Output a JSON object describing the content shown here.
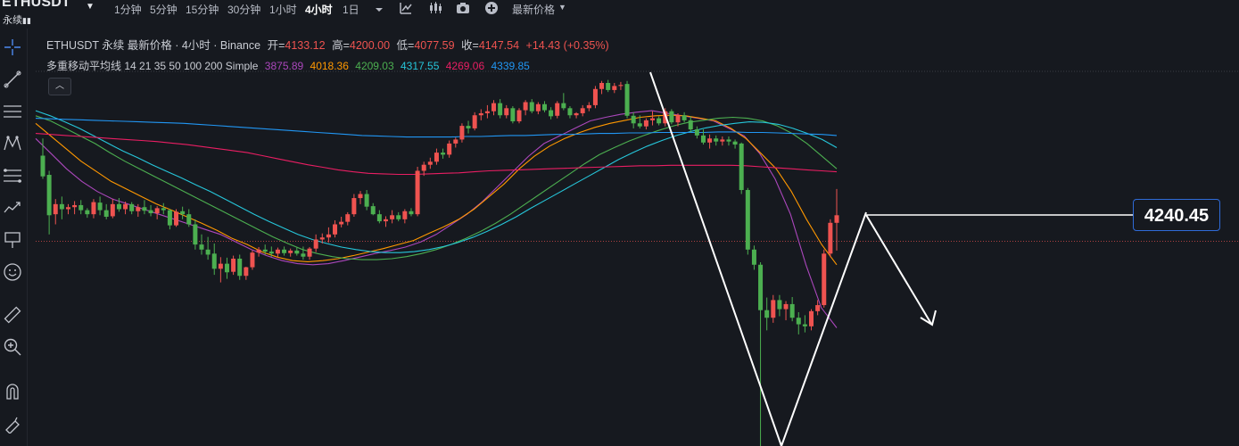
{
  "header": {
    "symbol": "ETHUSDT",
    "perp_tag": "永续",
    "timeframes": [
      {
        "label": "1分钟",
        "active": false
      },
      {
        "label": "5分钟",
        "active": false
      },
      {
        "label": "15分钟",
        "active": false
      },
      {
        "label": "30分钟",
        "active": false
      },
      {
        "label": "1小时",
        "active": false
      },
      {
        "label": "4小时",
        "active": true
      },
      {
        "label": "1日",
        "active": false
      }
    ],
    "icons": [
      "chevron-down-icon",
      "candle-style-icon",
      "indicator-icon",
      "camera-icon",
      "add-icon"
    ],
    "price_mode": "最新价格"
  },
  "toolbar": {
    "tools": [
      "crosshair-icon",
      "trend-line-icon",
      "horizontal-lines-icon",
      "pattern-icon",
      "fib-icon",
      "forecast-icon",
      "annotation-icon",
      "emoji-icon",
      "ruler-icon",
      "zoom-icon",
      "magnet-icon",
      "lock-drawing-icon"
    ]
  },
  "legend": {
    "title": "ETHUSDT 永续 最新价格 · 4小时 · Binance",
    "open_label": "开=",
    "open": "4133.12",
    "high_label": "高=",
    "high": "4200.00",
    "low_label": "低=",
    "low": "4077.59",
    "close_label": "收=",
    "close": "4147.54",
    "change": "+14.43 (+0.35%)",
    "ma_title": "多重移动平均线 14 21 35 50 100 200 Simple",
    "ma_values": [
      {
        "value": "3875.89",
        "color": "#ab47bc"
      },
      {
        "value": "4018.36",
        "color": "#ff9800"
      },
      {
        "value": "4209.03",
        "color": "#4caf50"
      },
      {
        "value": "4317.55",
        "color": "#26c6da"
      },
      {
        "value": "4269.06",
        "color": "#e91e63"
      },
      {
        "value": "4339.85",
        "color": "#2196f3"
      }
    ]
  },
  "collapse_button": "︿",
  "drawing": {
    "price_label": "4240.45"
  },
  "colors": {
    "background": "#16191f",
    "up": "#ef5350",
    "down": "#4caf50",
    "price_line": "#ef5350"
  },
  "chart_data": {
    "type": "candlestick",
    "symbol": "ETHUSDT",
    "interval": "4小时",
    "price_range": [
      3880,
      4410
    ],
    "candles": [
      [
        4266,
        4300,
        4220,
        4225
      ],
      [
        4228,
        4236,
        4110,
        4148
      ],
      [
        4150,
        4180,
        4130,
        4170
      ],
      [
        4170,
        4185,
        4140,
        4160
      ],
      [
        4160,
        4170,
        4150,
        4164
      ],
      [
        4164,
        4176,
        4150,
        4168
      ],
      [
        4168,
        4178,
        4150,
        4158
      ],
      [
        4158,
        4162,
        4143,
        4150
      ],
      [
        4150,
        4180,
        4142,
        4174
      ],
      [
        4173,
        4185,
        4148,
        4158
      ],
      [
        4158,
        4170,
        4140,
        4145
      ],
      [
        4146,
        4180,
        4142,
        4170
      ],
      [
        4170,
        4182,
        4155,
        4160
      ],
      [
        4160,
        4175,
        4150,
        4170
      ],
      [
        4170,
        4174,
        4150,
        4156
      ],
      [
        4156,
        4170,
        4145,
        4164
      ],
      [
        4164,
        4178,
        4150,
        4157
      ],
      [
        4158,
        4168,
        4146,
        4152
      ],
      [
        4152,
        4166,
        4140,
        4162
      ],
      [
        4162,
        4172,
        4150,
        4158
      ],
      [
        4158,
        4160,
        4120,
        4128
      ],
      [
        4128,
        4160,
        4125,
        4155
      ],
      [
        4156,
        4165,
        4140,
        4150
      ],
      [
        4150,
        4160,
        4125,
        4130
      ],
      [
        4130,
        4140,
        4080,
        4090
      ],
      [
        4090,
        4110,
        4070,
        4080
      ],
      [
        4080,
        4105,
        4060,
        4070
      ],
      [
        4072,
        4092,
        4030,
        4042
      ],
      [
        4042,
        4065,
        4015,
        4052
      ],
      [
        4052,
        4064,
        4022,
        4035
      ],
      [
        4036,
        4068,
        4030,
        4062
      ],
      [
        4062,
        4070,
        4020,
        4028
      ],
      [
        4028,
        4046,
        4020,
        4045
      ],
      [
        4045,
        4078,
        4040,
        4074
      ],
      [
        4074,
        4085,
        4066,
        4080
      ],
      [
        4080,
        4090,
        4070,
        4076
      ],
      [
        4076,
        4086,
        4066,
        4072
      ],
      [
        4072,
        4084,
        4065,
        4080
      ],
      [
        4080,
        4086,
        4068,
        4073
      ],
      [
        4073,
        4082,
        4066,
        4078
      ],
      [
        4078,
        4084,
        4068,
        4072
      ],
      [
        4072,
        4086,
        4060,
        4066
      ],
      [
        4066,
        4085,
        4060,
        4082
      ],
      [
        4082,
        4110,
        4075,
        4100
      ],
      [
        4100,
        4112,
        4092,
        4104
      ],
      [
        4104,
        4124,
        4094,
        4110
      ],
      [
        4110,
        4138,
        4104,
        4130
      ],
      [
        4130,
        4145,
        4124,
        4135
      ],
      [
        4135,
        4154,
        4128,
        4150
      ],
      [
        4150,
        4190,
        4145,
        4182
      ],
      [
        4182,
        4196,
        4170,
        4190
      ],
      [
        4190,
        4198,
        4158,
        4165
      ],
      [
        4166,
        4172,
        4148,
        4150
      ],
      [
        4150,
        4158,
        4132,
        4136
      ],
      [
        4136,
        4146,
        4125,
        4140
      ],
      [
        4140,
        4158,
        4132,
        4148
      ],
      [
        4148,
        4154,
        4136,
        4140
      ],
      [
        4140,
        4160,
        4132,
        4156
      ],
      [
        4156,
        4162,
        4146,
        4150
      ],
      [
        4150,
        4244,
        4146,
        4236
      ],
      [
        4236,
        4254,
        4226,
        4248
      ],
      [
        4248,
        4262,
        4240,
        4254
      ],
      [
        4254,
        4280,
        4248,
        4272
      ],
      [
        4272,
        4280,
        4260,
        4268
      ],
      [
        4268,
        4296,
        4262,
        4290
      ],
      [
        4290,
        4302,
        4282,
        4298
      ],
      [
        4298,
        4330,
        4292,
        4325
      ],
      [
        4325,
        4335,
        4310,
        4320
      ],
      [
        4320,
        4352,
        4316,
        4346
      ],
      [
        4346,
        4358,
        4336,
        4350
      ],
      [
        4350,
        4366,
        4340,
        4354
      ],
      [
        4354,
        4376,
        4346,
        4370
      ],
      [
        4370,
        4378,
        4340,
        4346
      ],
      [
        4346,
        4366,
        4340,
        4360
      ],
      [
        4360,
        4364,
        4330,
        4334
      ],
      [
        4334,
        4360,
        4330,
        4356
      ],
      [
        4356,
        4376,
        4346,
        4372
      ],
      [
        4372,
        4378,
        4350,
        4354
      ],
      [
        4354,
        4372,
        4348,
        4368
      ],
      [
        4368,
        4374,
        4352,
        4356
      ],
      [
        4356,
        4362,
        4338,
        4344
      ],
      [
        4345,
        4374,
        4340,
        4370
      ],
      [
        4370,
        4390,
        4356,
        4360
      ],
      [
        4360,
        4364,
        4340,
        4346
      ],
      [
        4346,
        4352,
        4340,
        4350
      ],
      [
        4350,
        4366,
        4344,
        4360
      ],
      [
        4360,
        4372,
        4354,
        4366
      ],
      [
        4366,
        4404,
        4360,
        4398
      ],
      [
        4398,
        4414,
        4388,
        4410
      ],
      [
        4410,
        4416,
        4392,
        4396
      ],
      [
        4396,
        4410,
        4390,
        4404
      ],
      [
        4404,
        4412,
        4396,
        4406
      ],
      [
        4408,
        4414,
        4340,
        4345
      ],
      [
        4345,
        4352,
        4320,
        4330
      ],
      [
        4330,
        4346,
        4320,
        4324
      ],
      [
        4324,
        4340,
        4318,
        4336
      ],
      [
        4336,
        4354,
        4326,
        4340
      ],
      [
        4340,
        4344,
        4326,
        4330
      ],
      [
        4330,
        4360,
        4324,
        4354
      ],
      [
        4354,
        4358,
        4328,
        4332
      ],
      [
        4332,
        4350,
        4324,
        4346
      ],
      [
        4346,
        4352,
        4332,
        4336
      ],
      [
        4336,
        4344,
        4312,
        4318
      ],
      [
        4318,
        4324,
        4300,
        4306
      ],
      [
        4306,
        4318,
        4288,
        4292
      ],
      [
        4292,
        4308,
        4280,
        4300
      ],
      [
        4300,
        4306,
        4286,
        4294
      ],
      [
        4294,
        4304,
        4286,
        4298
      ],
      [
        4298,
        4304,
        4286,
        4294
      ],
      [
        4294,
        4298,
        4280,
        4288
      ],
      [
        4290,
        4292,
        4190,
        4198
      ],
      [
        4198,
        4202,
        4070,
        4080
      ],
      [
        4080,
        4088,
        4040,
        4050
      ],
      [
        4050,
        4055,
        3680,
        3960
      ],
      [
        3960,
        3985,
        3920,
        3945
      ],
      [
        3945,
        3990,
        3935,
        3980
      ],
      [
        3980,
        3990,
        3948,
        3962
      ],
      [
        3962,
        3978,
        3940,
        3972
      ],
      [
        3972,
        3986,
        3938,
        3945
      ],
      [
        3945,
        3956,
        3912,
        3932
      ],
      [
        3932,
        3950,
        3916,
        3928
      ],
      [
        3928,
        3962,
        3920,
        3958
      ],
      [
        3958,
        3980,
        3950,
        3970
      ],
      [
        3970,
        4080,
        3965,
        4072
      ],
      [
        4072,
        4140,
        4065,
        4133
      ],
      [
        4133,
        4200,
        4078,
        4148
      ]
    ],
    "moving_averages": [
      {
        "period": 14,
        "color": "#ab47bc",
        "values": [
          4300,
          4270,
          4240,
          4215,
          4195,
          4180,
          4170,
          4160,
          4150,
          4140,
          4130,
          4120,
          4110,
          4095,
          4080,
          4068,
          4058,
          4052,
          4050,
          4052,
          4058,
          4065,
          4072,
          4078,
          4085,
          4095,
          4110,
          4130,
          4150,
          4175,
          4205,
          4235,
          4265,
          4290,
          4305,
          4320,
          4335,
          4342,
          4348,
          4352,
          4355,
          4350,
          4345,
          4340,
          4335,
          4320,
          4305,
          4270,
          4220,
          4150,
          4050,
          3965,
          3925
        ]
      },
      {
        "period": 21,
        "color": "#ff9800",
        "values": [
          4330,
          4305,
          4280,
          4255,
          4235,
          4215,
          4200,
          4185,
          4170,
          4158,
          4145,
          4132,
          4118,
          4102,
          4090,
          4075,
          4065,
          4058,
          4056,
          4058,
          4062,
          4068,
          4075,
          4082,
          4090,
          4098,
          4112,
          4125,
          4140,
          4160,
          4185,
          4210,
          4240,
          4265,
          4285,
          4300,
          4312,
          4322,
          4330,
          4336,
          4342,
          4345,
          4346,
          4345,
          4340,
          4335,
          4320,
          4300,
          4270,
          4240,
          4195,
          4140,
          4090,
          4050
        ]
      },
      {
        "period": 35,
        "color": "#4caf50",
        "values": [
          4345,
          4335,
          4320,
          4305,
          4290,
          4272,
          4255,
          4240,
          4225,
          4210,
          4195,
          4180,
          4165,
          4150,
          4135,
          4120,
          4105,
          4092,
          4080,
          4072,
          4066,
          4062,
          4060,
          4060,
          4062,
          4066,
          4072,
          4080,
          4090,
          4102,
          4116,
          4132,
          4150,
          4170,
          4190,
          4210,
          4230,
          4250,
          4268,
          4282,
          4295,
          4306,
          4316,
          4325,
          4332,
          4336,
          4340,
          4342,
          4340,
          4335,
          4325,
          4310,
          4290,
          4265,
          4240
        ]
      },
      {
        "period": 50,
        "color": "#26c6da",
        "values": [
          4355,
          4345,
          4333,
          4320,
          4305,
          4290,
          4275,
          4262,
          4248,
          4235,
          4222,
          4208,
          4195,
          4180,
          4165,
          4150,
          4136,
          4123,
          4110,
          4100,
          4092,
          4085,
          4080,
          4076,
          4074,
          4074,
          4076,
          4080,
          4086,
          4094,
          4104,
          4116,
          4130,
          4145,
          4162,
          4178,
          4194,
          4210,
          4226,
          4242,
          4258,
          4272,
          4285,
          4296,
          4306,
          4314,
          4321,
          4326,
          4330,
          4333,
          4332,
          4328,
          4320,
          4310,
          4298,
          4282
        ]
      },
      {
        "period": 100,
        "color": "#e91e63",
        "values": [
          4310,
          4308,
          4306,
          4304,
          4302,
          4300,
          4298,
          4296,
          4294,
          4291,
          4288,
          4284,
          4280,
          4276,
          4272,
          4266,
          4260,
          4254,
          4248,
          4243,
          4238,
          4234,
          4231,
          4230,
          4229,
          4229,
          4230,
          4231,
          4232,
          4234,
          4236,
          4237,
          4238,
          4239,
          4240,
          4241,
          4242,
          4243,
          4244,
          4245,
          4246,
          4246,
          4247,
          4247,
          4247,
          4247,
          4247,
          4246,
          4244,
          4242,
          4240,
          4238,
          4236,
          4234
        ]
      },
      {
        "period": 200,
        "color": "#2196f3",
        "values": [
          4340,
          4339,
          4338,
          4337,
          4336,
          4335,
          4334,
          4333,
          4332,
          4331,
          4330,
          4328,
          4326,
          4324,
          4322,
          4320,
          4318,
          4316,
          4314,
          4312,
          4310,
          4308,
          4306,
          4305,
          4304,
          4303,
          4303,
          4303,
          4303,
          4304,
          4304,
          4305,
          4306,
          4306,
          4307,
          4308,
          4308,
          4309,
          4310,
          4310,
          4311,
          4311,
          4312,
          4312,
          4312,
          4312,
          4313,
          4313,
          4312,
          4312,
          4311,
          4310,
          4309,
          4308,
          4306
        ]
      }
    ]
  }
}
